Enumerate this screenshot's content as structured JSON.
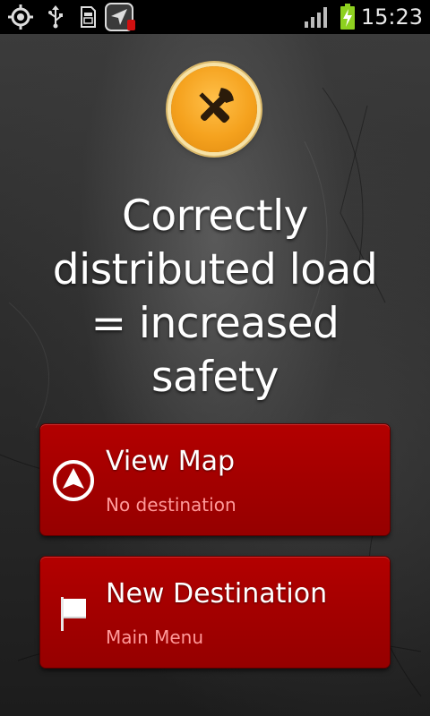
{
  "status_bar": {
    "time": "15:23",
    "icons": [
      "gps-icon",
      "usb-icon",
      "sd-card-icon",
      "navigation-app-icon",
      "signal-icon",
      "battery-charging-icon"
    ]
  },
  "logo": {
    "icon": "tools-icon",
    "color": "#f5a21e"
  },
  "headline": {
    "lines": [
      "Correctly",
      "distributed load",
      "= increased",
      "safety"
    ]
  },
  "menu": {
    "view_map": {
      "title": "View Map",
      "subtitle": "No destination",
      "icon": "navigation-arrow-icon"
    },
    "new_destination": {
      "title": "New Destination",
      "subtitle": "Main Menu",
      "icon": "flag-icon"
    }
  },
  "colors": {
    "button_red": "#a30000",
    "subtitle_pink": "#ff9a9a",
    "battery_green": "#8ed11f"
  }
}
